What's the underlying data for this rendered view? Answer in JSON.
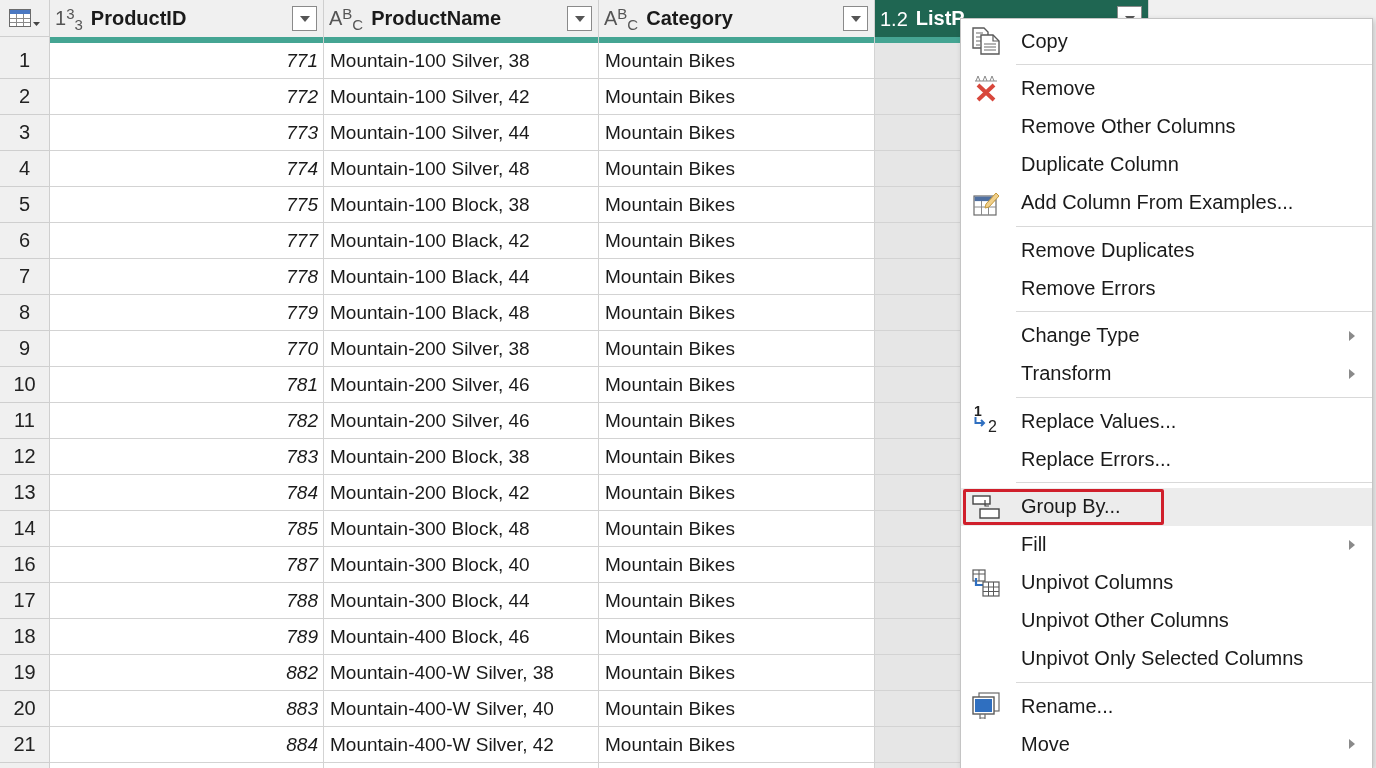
{
  "grid": {
    "columns": [
      {
        "type_label": "1$^{3}$$_{3}$",
        "name": "ProductID",
        "kind": "whole_number",
        "selected": false
      },
      {
        "type_label": "A$^{B}$$_{C}$",
        "name": "ProductName",
        "kind": "text",
        "selected": false
      },
      {
        "type_label": "A$^{B}$$_{C}$",
        "name": "Category",
        "kind": "text",
        "selected": false
      },
      {
        "type_label": "1.2",
        "name": "ListP",
        "kind": "decimal",
        "selected": true
      }
    ],
    "rows": [
      {
        "number": "1",
        "cells": [
          "771",
          "Mountain-100 Silver, 38",
          "Mountain Bikes"
        ]
      },
      {
        "number": "2",
        "cells": [
          "772",
          "Mountain-100 Silver, 42",
          "Mountain Bikes"
        ]
      },
      {
        "number": "3",
        "cells": [
          "773",
          "Mountain-100 Silver, 44",
          "Mountain Bikes"
        ]
      },
      {
        "number": "4",
        "cells": [
          "774",
          "Mountain-100 Silver, 48",
          "Mountain Bikes"
        ]
      },
      {
        "number": "5",
        "cells": [
          "775",
          "Mountain-100 Block, 38",
          "Mountain Bikes"
        ]
      },
      {
        "number": "6",
        "cells": [
          "777",
          "Mountain-100 Black, 42",
          "Mountain Bikes"
        ]
      },
      {
        "number": "7",
        "cells": [
          "778",
          "Mountain-100 Black, 44",
          "Mountain Bikes"
        ]
      },
      {
        "number": "8",
        "cells": [
          "779",
          "Mountain-100 Black, 48",
          "Mountain Bikes"
        ]
      },
      {
        "number": "9",
        "cells": [
          "770",
          "Mountain-200 Silver, 38",
          "Mountain Bikes"
        ]
      },
      {
        "number": "10",
        "cells": [
          "781",
          "Mountain-200 Silver, 46",
          "Mountain Bikes"
        ]
      },
      {
        "number": "11",
        "cells": [
          "782",
          "Mountain-200 Silver, 46",
          "Mountain Bikes"
        ]
      },
      {
        "number": "12",
        "cells": [
          "783",
          "Mountain-200 Block, 38",
          "Mountain Bikes"
        ]
      },
      {
        "number": "13",
        "cells": [
          "784",
          "Mountain-200 Block, 42",
          "Mountain Bikes"
        ]
      },
      {
        "number": "14",
        "cells": [
          "785",
          "Mountain-300 Block, 48",
          "Mountain Bikes"
        ]
      },
      {
        "number": "16",
        "cells": [
          "787",
          "Mountain-300 Block, 40",
          "Mountain Bikes"
        ]
      },
      {
        "number": "17",
        "cells": [
          "788",
          "Mountain-300 Block, 44",
          "Mountain Bikes"
        ]
      },
      {
        "number": "18",
        "cells": [
          "789",
          "Mountain-400 Block, 46",
          "Mountain Bikes"
        ]
      },
      {
        "number": "19",
        "cells": [
          "882",
          "Mountain-400-W Silver, 38",
          "Mountain Bikes"
        ]
      },
      {
        "number": "20",
        "cells": [
          "883",
          "Mountain-400-W Silver, 40",
          "Mountain Bikes"
        ]
      },
      {
        "number": "21",
        "cells": [
          "884",
          "Mountain-400-W Silver, 42",
          "Mountain Bikes"
        ]
      }
    ]
  },
  "menu": {
    "groups": [
      {
        "items": [
          {
            "label": "Copy",
            "kind": "copy",
            "selected": false,
            "highlighted": false
          }
        ]
      },
      {
        "items": [
          {
            "label": "Remove",
            "kind": "remove",
            "selected": false,
            "highlighted": false
          },
          {
            "label": "Remove Other Columns",
            "kind": "plain",
            "selected": false,
            "highlighted": false
          },
          {
            "label": "Duplicate Column",
            "kind": "plain",
            "selected": false,
            "highlighted": false
          },
          {
            "label": "Add Column From Examples...",
            "kind": "examples",
            "selected": false,
            "highlighted": false
          }
        ]
      },
      {
        "items": [
          {
            "label": "Remove Duplicates",
            "kind": "plain",
            "selected": false,
            "highlighted": false
          },
          {
            "label": "Remove Errors",
            "kind": "plain",
            "selected": false,
            "highlighted": false
          }
        ]
      },
      {
        "items": [
          {
            "label": "Change Type",
            "kind": "submenu",
            "selected": false,
            "highlighted": false
          },
          {
            "label": "Transform",
            "kind": "submenu",
            "selected": false,
            "highlighted": false
          }
        ]
      },
      {
        "items": [
          {
            "label": "Replace Values...",
            "kind": "replace",
            "icon_text": [
              "1",
              "2"
            ],
            "selected": false,
            "highlighted": false
          },
          {
            "label": "Replace Errors...",
            "kind": "plain",
            "selected": false,
            "highlighted": false
          }
        ]
      },
      {
        "items": [
          {
            "label": "Group By...",
            "kind": "group",
            "selected": true,
            "highlighted": true
          },
          {
            "label": "Fill",
            "kind": "submenu",
            "selected": false,
            "highlighted": false
          },
          {
            "label": "Unpivot Columns",
            "kind": "unpivot",
            "selected": false,
            "highlighted": false
          },
          {
            "label": "Unpivot Other Columns",
            "kind": "plain",
            "selected": false,
            "highlighted": false
          },
          {
            "label": "Unpivot Only Selected Columns",
            "kind": "plain",
            "selected": false,
            "highlighted": false
          }
        ]
      },
      {
        "items": [
          {
            "label": "Rename...",
            "kind": "rename",
            "selected": false,
            "highlighted": false
          },
          {
            "label": "Move",
            "kind": "submenu",
            "selected": false,
            "highlighted": false
          }
        ]
      }
    ]
  }
}
